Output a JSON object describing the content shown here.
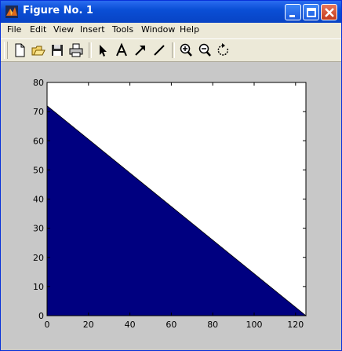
{
  "window": {
    "title": "Figure No. 1",
    "title_icon": "matlab-logo-icon",
    "titlebar_color": "#0a4fd6",
    "controls": [
      "minimize-icon",
      "maximize-icon",
      "close-icon"
    ]
  },
  "menu": {
    "items": [
      "File",
      "Edit",
      "View",
      "Insert",
      "Tools",
      "Window",
      "Help"
    ]
  },
  "toolbar": {
    "tools": [
      "new-figure-icon",
      "open-file-icon",
      "save-icon",
      "print-icon",
      "select-arrow-icon",
      "insert-text-icon",
      "insert-arrow-icon",
      "insert-line-icon",
      "zoom-in-icon",
      "zoom-out-icon",
      "rotate-3d-icon"
    ]
  },
  "figure": {
    "background": "#c8c8c8"
  },
  "chart_data": {
    "type": "area",
    "x": [
      0,
      125
    ],
    "y": [
      72,
      0
    ],
    "fill_color": "#000080",
    "xlim": [
      0,
      125
    ],
    "ylim": [
      0,
      80
    ],
    "xticks": [
      0,
      20,
      40,
      60,
      80,
      100,
      120
    ],
    "yticks": [
      0,
      10,
      20,
      30,
      40,
      50,
      60,
      70,
      80
    ],
    "xtick_labels": [
      "0",
      "20",
      "40",
      "60",
      "80",
      "100",
      "120"
    ],
    "ytick_labels": [
      "0",
      "10",
      "20",
      "30",
      "40",
      "50",
      "60",
      "70",
      "80"
    ],
    "grid": false,
    "title": "",
    "xlabel": "",
    "ylabel": ""
  }
}
